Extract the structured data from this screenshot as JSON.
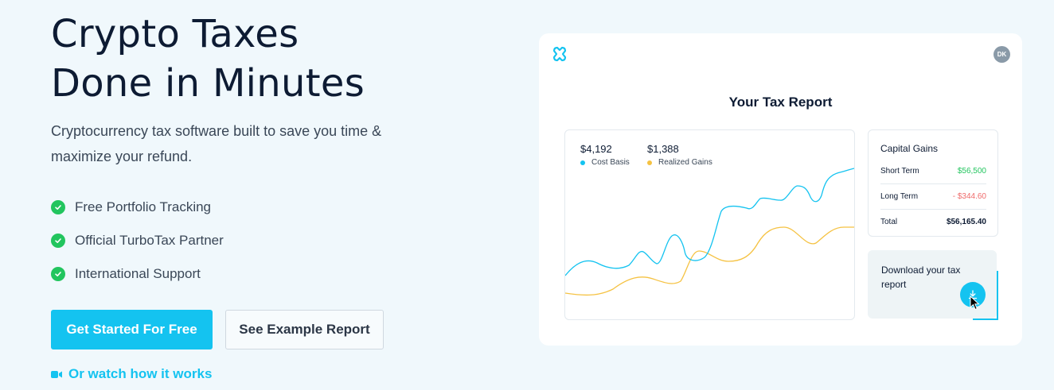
{
  "hero": {
    "title_line1": "Crypto Taxes",
    "title_line2": "Done in Minutes",
    "subtitle": "Cryptocurrency tax software built to save you time & maximize your refund."
  },
  "features": [
    "Free Portfolio Tracking",
    "Official TurboTax Partner",
    "International Support"
  ],
  "cta": {
    "primary_label": "Get Started For Free",
    "secondary_label": "See Example Report",
    "watch_label": "Or watch how it works"
  },
  "card": {
    "avatar_initials": "DK",
    "report_title": "Your Tax Report",
    "stats": [
      {
        "value": "$4,192",
        "label": "Cost Basis",
        "color": "#14c3f0"
      },
      {
        "value": "$1,388",
        "label": "Realized Gains",
        "color": "#f5c242"
      }
    ],
    "capital_gains": {
      "title": "Capital Gains",
      "rows": [
        {
          "label": "Short Term",
          "value": "$56,500",
          "tone": "green"
        },
        {
          "label": "Long Term",
          "value": "- $344.60",
          "tone": "red"
        },
        {
          "label": "Total",
          "value": "$56,165.40",
          "tone": "bold"
        }
      ]
    },
    "download_text": "Download your tax report"
  },
  "colors": {
    "accent": "#14c3f0",
    "check_green": "#22c55e",
    "gold": "#f5c242",
    "negative_red": "#ef6b6b"
  },
  "icons": [
    "check-circle-icon",
    "video-camera-icon",
    "app-logo-icon",
    "download-icon",
    "mouse-cursor-icon"
  ]
}
